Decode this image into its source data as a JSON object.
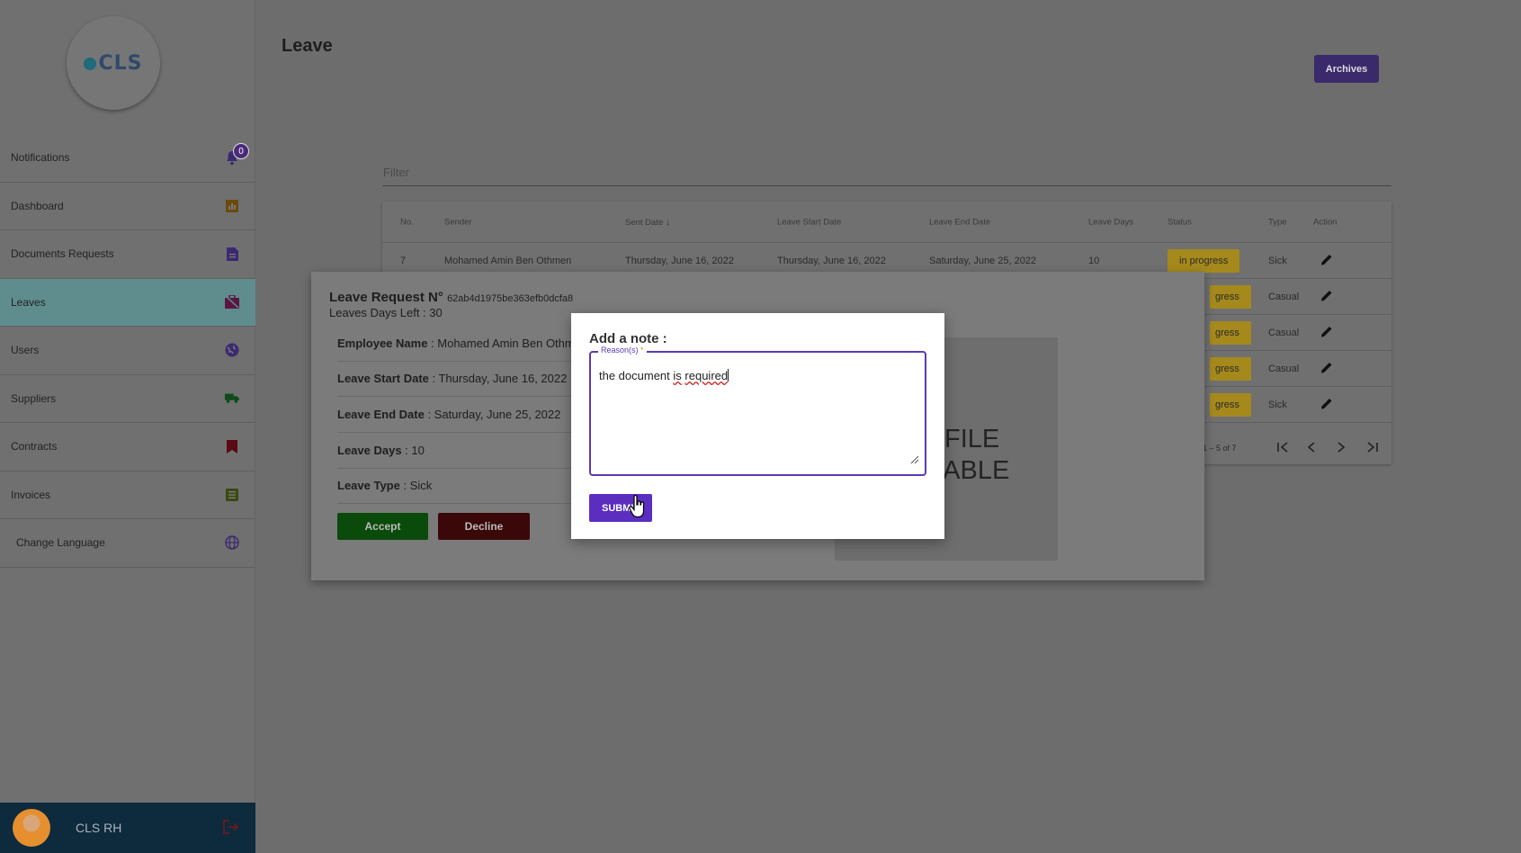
{
  "sidebar": {
    "logo_text": "CLS",
    "items": [
      {
        "label": "Notifications",
        "badge": "0",
        "icon": "bell-icon"
      },
      {
        "label": "Dashboard",
        "icon": "chart-icon"
      },
      {
        "label": "Documents Requests",
        "icon": "document-icon"
      },
      {
        "label": "Leaves",
        "icon": "briefcase-icon",
        "active": true
      },
      {
        "label": "Users",
        "icon": "globe-icon"
      },
      {
        "label": "Suppliers",
        "icon": "truck-icon"
      },
      {
        "label": "Contracts",
        "icon": "bookmark-icon"
      },
      {
        "label": "Invoices",
        "icon": "list-icon"
      },
      {
        "label": "Change Language",
        "icon": "language-icon"
      }
    ],
    "profile": {
      "name": "CLS RH"
    }
  },
  "header": {
    "title": "Leave",
    "archives_label": "Archives"
  },
  "filter": {
    "placeholder": "Filter"
  },
  "table": {
    "headers": [
      "No.",
      "Sender",
      "Sent Date",
      "Leave Start Date",
      "Leave End Date",
      "Leave Days",
      "Status",
      "Type",
      "Action"
    ],
    "rows": [
      {
        "no": "7",
        "sender": "Mohamed Amin Ben Othmen",
        "sent": "Thursday, June 16, 2022",
        "start": "Thursday, June 16, 2022",
        "end": "Saturday, June 25, 2022",
        "days": "10",
        "status": "in progress",
        "type": "Sick"
      },
      {
        "status": "gress",
        "type": "Casual"
      },
      {
        "status": "gress",
        "type": "Casual"
      },
      {
        "status": "gress",
        "type": "Casual"
      },
      {
        "status": "gress",
        "type": "Sick"
      }
    ],
    "range_label": "1 – 5 of 7"
  },
  "modal": {
    "title": "Leave Request N°",
    "request_id": "62ab4d1975be363efb0dcfa8",
    "days_left": "Leaves Days Left : 30",
    "fields": [
      {
        "label": "Employee Name",
        "value": " : Mohamed Amin Ben Othmen"
      },
      {
        "label": "Leave Start Date",
        "value": " : Thursday, June 16, 2022"
      },
      {
        "label": "Leave End Date",
        "value": " : Saturday, June 25, 2022"
      },
      {
        "label": "Leave Days",
        "value": " : 10"
      },
      {
        "label": "Leave Type",
        "value": " : Sick"
      }
    ],
    "accept_label": "Accept",
    "decline_label": "Decline",
    "nofile_line1": "FILE",
    "nofile_line2": "LABLE"
  },
  "note_dialog": {
    "title": "Add a note :",
    "field_label": "Reason(s)",
    "required_mark": "*",
    "text_a": "the document ",
    "text_b": "is",
    "text_c": " ",
    "text_d": "required",
    "submit_label": "SUBMIT"
  }
}
